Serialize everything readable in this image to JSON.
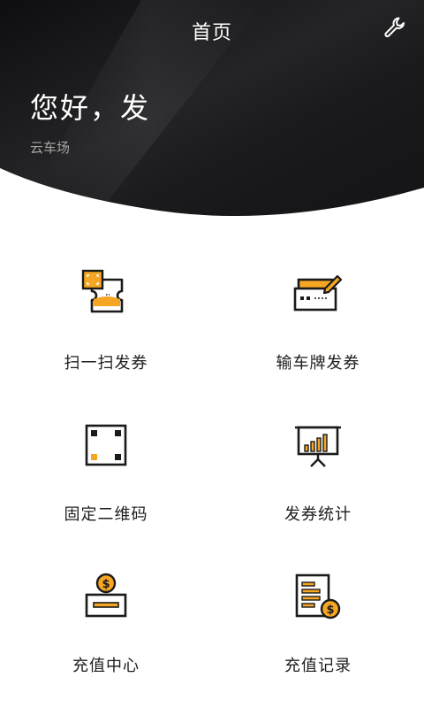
{
  "header": {
    "title": "首页",
    "settings_icon": "wrench-icon",
    "greeting": "您好，发",
    "lot_name": "云车场"
  },
  "colors": {
    "dark_bg": "#1c1c1e",
    "accent": "#f5a623",
    "icon_stroke": "#1a1a1a"
  },
  "menu": [
    {
      "label": "扫一扫发券",
      "icon": "scan-ticket-icon"
    },
    {
      "label": "输车牌发券",
      "icon": "plate-input-icon"
    },
    {
      "label": "固定二维码",
      "icon": "fixed-qrcode-icon"
    },
    {
      "label": "发券统计",
      "icon": "statistics-icon"
    },
    {
      "label": "充值中心",
      "icon": "recharge-icon"
    },
    {
      "label": "充值记录",
      "icon": "recharge-record-icon"
    }
  ]
}
